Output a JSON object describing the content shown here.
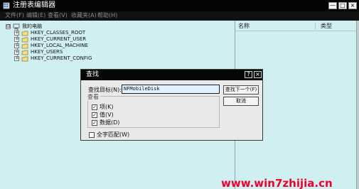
{
  "window": {
    "title": "注册表编辑器",
    "controls": {
      "minimize": "—",
      "maximize": "□",
      "close": "×"
    }
  },
  "menu": {
    "items": [
      "文件(F)",
      "编辑(E)",
      "查看(V)",
      "收藏夹(A)",
      "帮助(H)"
    ]
  },
  "tree": {
    "root": {
      "label": "我的电脑",
      "expander": "⊟"
    },
    "children": [
      {
        "label": "HKEY_CLASSES_ROOT",
        "expander": "+"
      },
      {
        "label": "HKEY_CURRENT_USER",
        "expander": "+"
      },
      {
        "label": "HKEY_LOCAL_MACHINE",
        "expander": "+"
      },
      {
        "label": "HKEY_USERS",
        "expander": "+"
      },
      {
        "label": "HKEY_CURRENT_CONFIG",
        "expander": "+"
      }
    ]
  },
  "list": {
    "headers": [
      "名称",
      "类型"
    ]
  },
  "dialog": {
    "title": "查找",
    "help": "?",
    "close": "×",
    "find_label": "查找目标(N):",
    "find_value": "NFMobileDisk",
    "find_next_button": "查找下一个(F)",
    "cancel_button": "取消",
    "look_in_title": "查看",
    "options": [
      {
        "label": "项(K)",
        "checked": true
      },
      {
        "label": "值(V)",
        "checked": true
      },
      {
        "label": "数据(D)",
        "checked": true
      }
    ],
    "match_whole": {
      "label": "全字匹配(W)",
      "checked": false
    }
  },
  "watermark": {
    "text": "www.win7zhijia.cn"
  },
  "colors": {
    "window_background": "#cfeff1",
    "titlebar": "#040404",
    "dialog_background": "#e9e9e9",
    "watermark": "#f0002d"
  },
  "icons": {
    "app": "registry-editor-icon",
    "computer": "computer-icon",
    "folder": "folder-icon",
    "checkbox_checked": "checkmark-icon"
  }
}
